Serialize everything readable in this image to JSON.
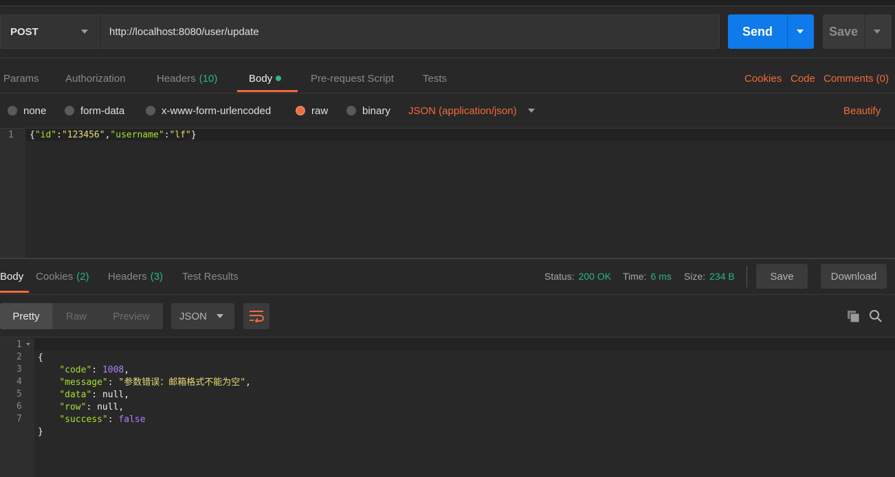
{
  "request": {
    "method": "POST",
    "url": "http://localhost:8080/user/update",
    "send_label": "Send",
    "save_label": "Save"
  },
  "request_tabs": {
    "params": "Params",
    "authorization": "Authorization",
    "headers": "Headers",
    "headers_count": "(10)",
    "body": "Body",
    "prerequest": "Pre-request Script",
    "tests": "Tests",
    "cookies": "Cookies",
    "code": "Code",
    "comments": "Comments (0)"
  },
  "body_options": {
    "none": "none",
    "form_data": "form-data",
    "urlencoded": "x-www-form-urlencoded",
    "raw": "raw",
    "binary": "binary",
    "content_type": "JSON (application/json)",
    "beautify": "Beautify",
    "selected": "raw"
  },
  "request_body": {
    "line_number": "1",
    "tokens": [
      "{",
      "\"id\"",
      ":",
      "\"123456\"",
      ",",
      "\"username\"",
      ":",
      "\"lf\"",
      "}"
    ]
  },
  "response_tabs": {
    "body": "Body",
    "cookies": "Cookies",
    "cookies_count": "(2)",
    "headers": "Headers",
    "headers_count": "(3)",
    "test_results": "Test Results"
  },
  "response_meta": {
    "status_label": "Status:",
    "status_value": "200 OK",
    "time_label": "Time:",
    "time_value": "6 ms",
    "size_label": "Size:",
    "size_value": "234 B",
    "save_label": "Save",
    "download_label": "Download"
  },
  "response_toolbar": {
    "pretty": "Pretty",
    "raw": "Raw",
    "preview": "Preview",
    "format": "JSON",
    "active": "Pretty"
  },
  "response_body": {
    "line_numbers": [
      "1",
      "2",
      "3",
      "4",
      "5",
      "6",
      "7"
    ],
    "open_brace": "{",
    "close_brace": "}",
    "fields": [
      {
        "key": "\"code\"",
        "value": "1008",
        "type": "number"
      },
      {
        "key": "\"message\"",
        "value": "\"参数错误：邮箱格式不能为空\"",
        "type": "string"
      },
      {
        "key": "\"data\"",
        "value": "null",
        "type": "null"
      },
      {
        "key": "\"row\"",
        "value": "null",
        "type": "null"
      },
      {
        "key": "\"success\"",
        "value": "false",
        "type": "boolean"
      }
    ]
  },
  "colors": {
    "accent": "#f26b3a",
    "primary": "#0f7aea",
    "success": "#2eb67d",
    "json_key": "#a6e22e",
    "json_string": "#e6db74",
    "json_number": "#ae81ff"
  }
}
